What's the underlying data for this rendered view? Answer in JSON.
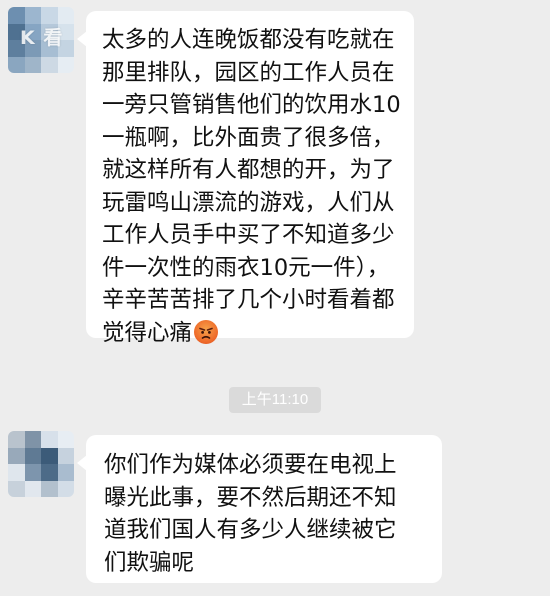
{
  "watermark": {
    "text": "K 看"
  },
  "messages": [
    {
      "sender": "incoming",
      "lines": [
        "太多的人连晚饭都没有吃就在",
        "那里排队，园区的工作人员在",
        "一旁只管销售他们的饮用水10",
        "一瓶啊，比外面贵了很多倍，",
        "就这样所有人都想的开，为了",
        "玩雷鸣山漂流的游戏，人们从",
        "工作人员手中买了不知道多少",
        "件一次性的雨衣10元一件），",
        "辛辛苦苦排了几个小时看着都",
        "觉得心痛"
      ],
      "emoji": "angry-face"
    },
    {
      "sender": "incoming",
      "lines": [
        "你们作为媒体必须要在电视上",
        "曝光此事，要不然后期还不知",
        "道我们国人有多少人继续被它",
        "们欺骗呢"
      ]
    }
  ],
  "timestamp": "上午11:10",
  "colors": {
    "background": "#ededed",
    "bubble": "#ffffff",
    "timestamp_bg": "#dadada",
    "timestamp_text": "#ffffff"
  },
  "avatar_pixels_1": [
    "#6d8fb0",
    "#9cb6cf",
    "#c9d8e6",
    "#e3ebf2",
    "#4f7191",
    "#86a5c3",
    "#b5c8da",
    "#d6e2ec",
    "#5e7f9e",
    "#7c9ab6",
    "#a7bed3",
    "#c4d4e2",
    "#8aa6c0",
    "#9fb5c9",
    "#cdd9e4",
    "#e6edf3"
  ],
  "avatar_pixels_2": [
    "#b9c3cd",
    "#7f93a7",
    "#d7e0ea",
    "#e7edf3",
    "#98a9ba",
    "#5f7a94",
    "#3c5b79",
    "#c6d2de",
    "#dfe6ed",
    "#7d95ad",
    "#4d6b88",
    "#a9bccf",
    "#c7d1db",
    "#e1e7ee",
    "#b2c0cd",
    "#d3dde7"
  ]
}
